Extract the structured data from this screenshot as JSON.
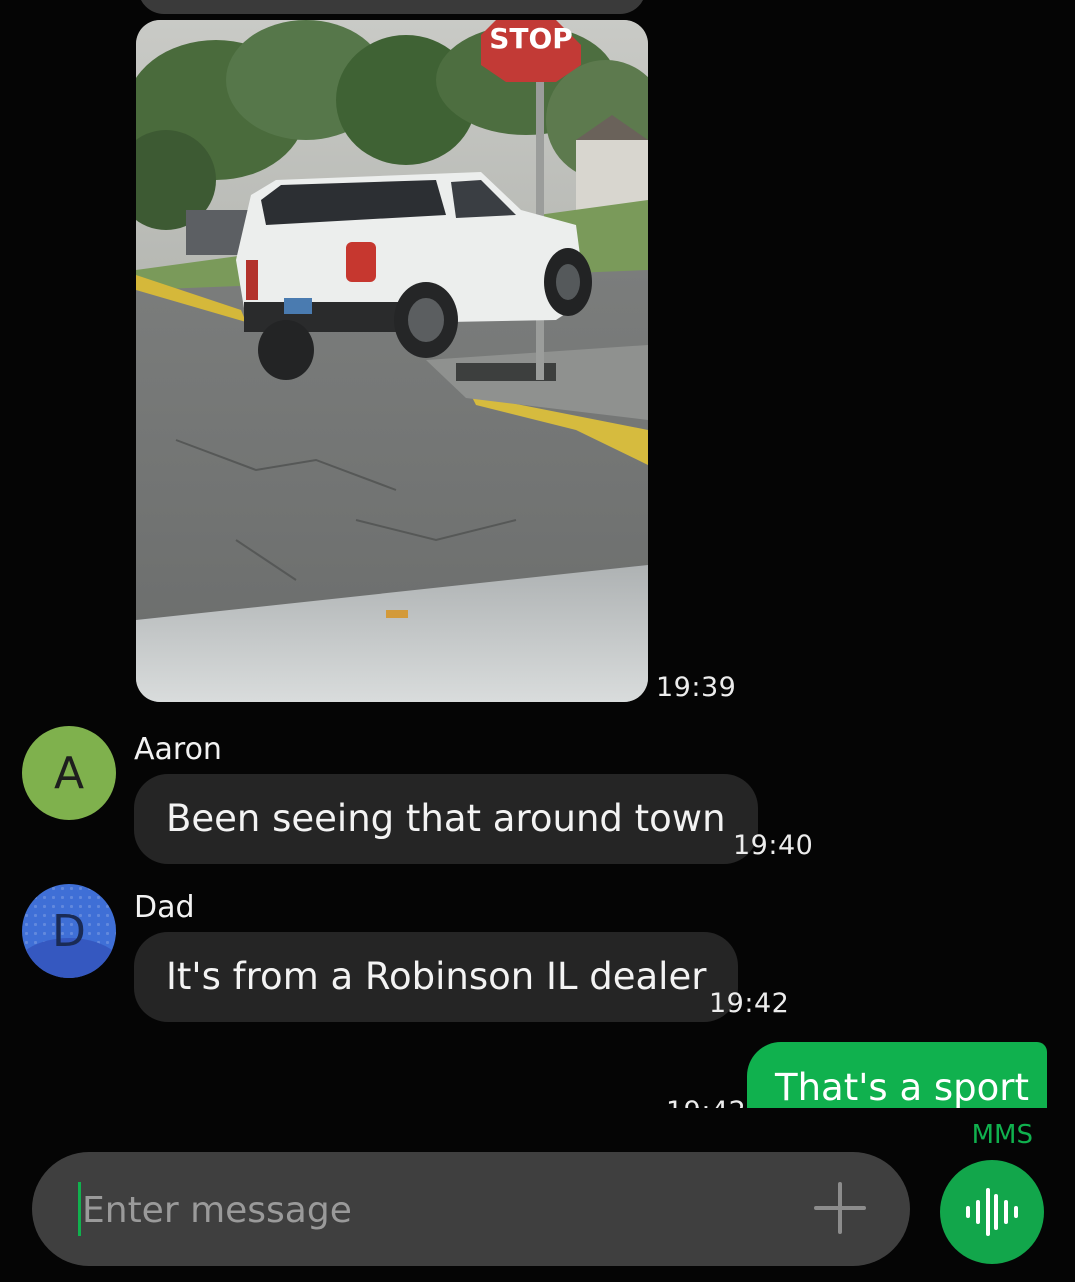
{
  "thread": {
    "photo_message": {
      "time": "19:39",
      "image_alt": "Photo of a white SUV at a stop sign",
      "sign_text": "STOP"
    },
    "messages": [
      {
        "sender": "Aaron",
        "avatar_letter": "A",
        "text": "Been seeing that around town",
        "time": "19:40"
      },
      {
        "sender": "Dad",
        "avatar_letter": "D",
        "text": "It's from a Robinson IL dealer",
        "time": "19:42"
      }
    ],
    "outgoing": {
      "text": "That's a sport",
      "time": "19:42"
    }
  },
  "composer": {
    "placeholder": "Enter message",
    "mode_label": "MMS",
    "add_icon": "plus-icon",
    "voice_icon": "voice-waveform-icon"
  },
  "colors": {
    "background": "#050505",
    "incoming_bubble": "#252525",
    "outgoing_bubble": "#10b14e",
    "accent": "#10b14e",
    "avatar_aaron": "#7fb14d",
    "avatar_dad": "#3f6fd6"
  }
}
